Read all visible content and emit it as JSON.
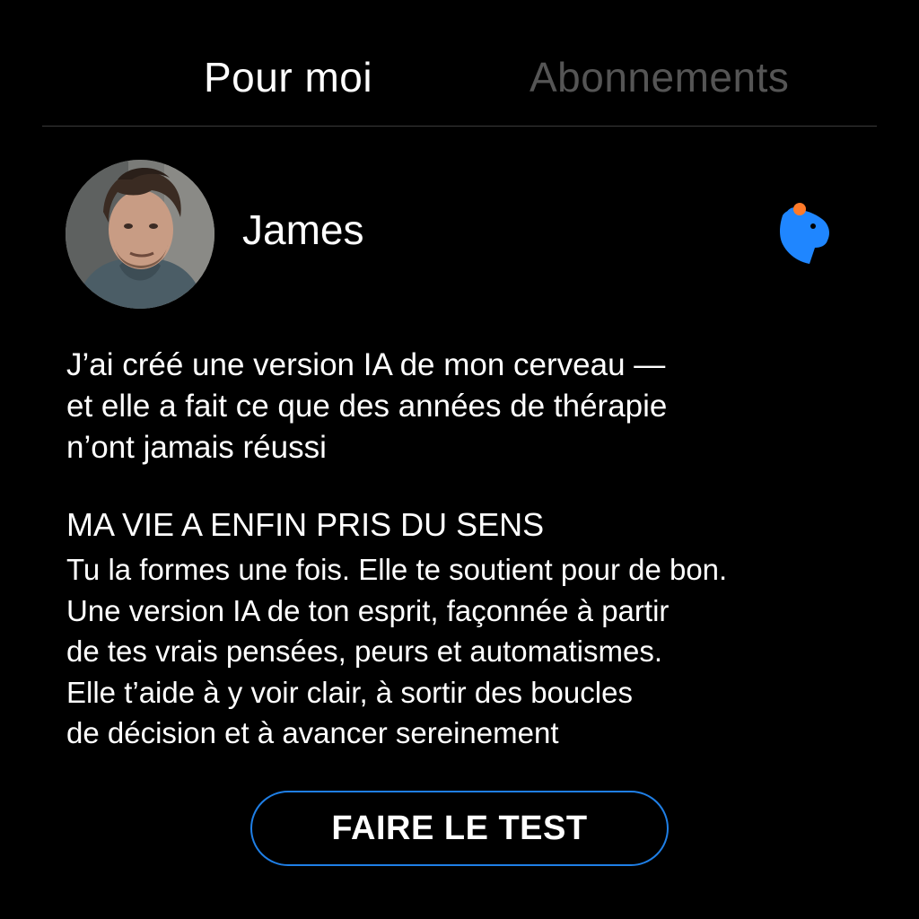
{
  "tabs": [
    {
      "label": "Pour moi",
      "active": true
    },
    {
      "label": "Abonnements",
      "active": false
    }
  ],
  "post": {
    "author": "James",
    "avatar_icon": "profile-photo",
    "brand_icon": "capybara-logo-icon",
    "title_lines": [
      "J’ai créé une version IA de mon cerveau —",
      "et elle a fait ce que des années de thérapie",
      "n’ont jamais réussi"
    ],
    "headline": "MA VIE A ENFIN PRIS DU SENS",
    "body_lines": [
      "Tu la formes une fois. Elle te soutient pour de bon.",
      "Une version IA de ton esprit, façonnée à partir",
      "de tes vrais pensées, peurs et automatismes.",
      "Elle t’aide à y voir clair, à sortir des boucles",
      "de décision et à avancer sereinement"
    ],
    "cta_label": "FAIRE LE TEST"
  },
  "colors": {
    "background": "#000000",
    "text": "#ffffff",
    "inactive_tab": "#555555",
    "accent_blue": "#1f7fe6",
    "logo_dot": "#ff7a2a"
  }
}
